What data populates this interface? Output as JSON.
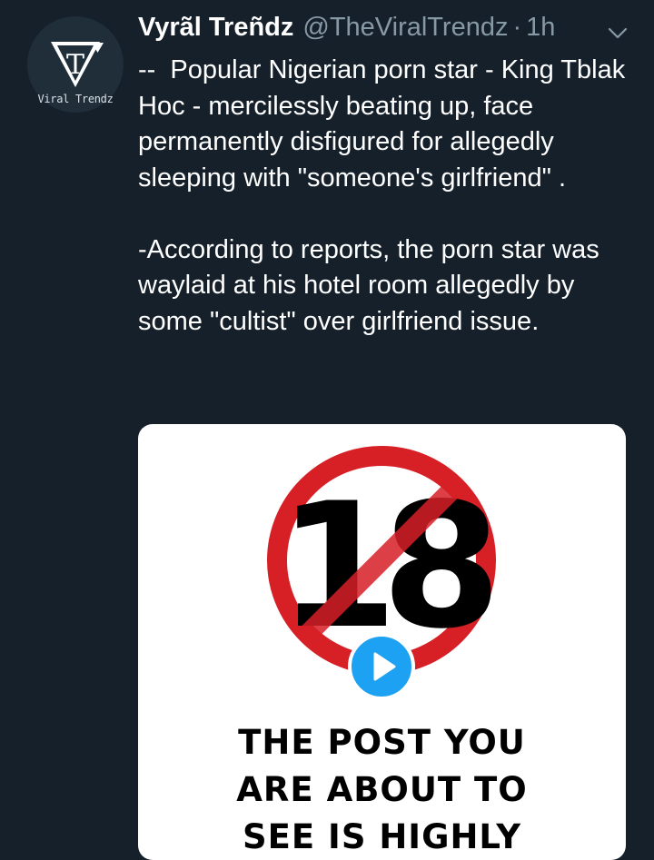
{
  "tweet": {
    "display_name": "Vyrãl Treñdz",
    "handle": "@TheViralTrendz",
    "separator": "·",
    "time": "1h",
    "text": "--  Popular Nigerian porn star - King Tblak Hoc - mercilessly beating up, face permanently disfigured for allegedly sleeping with \"someone's girlfriend\" .\n\n-According to reports, the porn star was waylaid at his hotel room allegedly by some \"cultist\" over girlfriend issue."
  },
  "avatar": {
    "logo_letter": "T",
    "brand_text": "Viral Trendz"
  },
  "media": {
    "sign_number": "18",
    "warning_lines": [
      "THE POST YOU",
      "ARE ABOUT TO",
      "SEE IS HIGHLY"
    ]
  },
  "icons": {
    "more": "chevron-down-icon",
    "play": "play-icon",
    "no_symbol": "no-entry-sign-icon"
  },
  "colors": {
    "background": "#15202b",
    "text": "#ffffff",
    "secondary": "#8899a6",
    "accent": "#1da1f2",
    "sign_red": "#d71f26"
  }
}
